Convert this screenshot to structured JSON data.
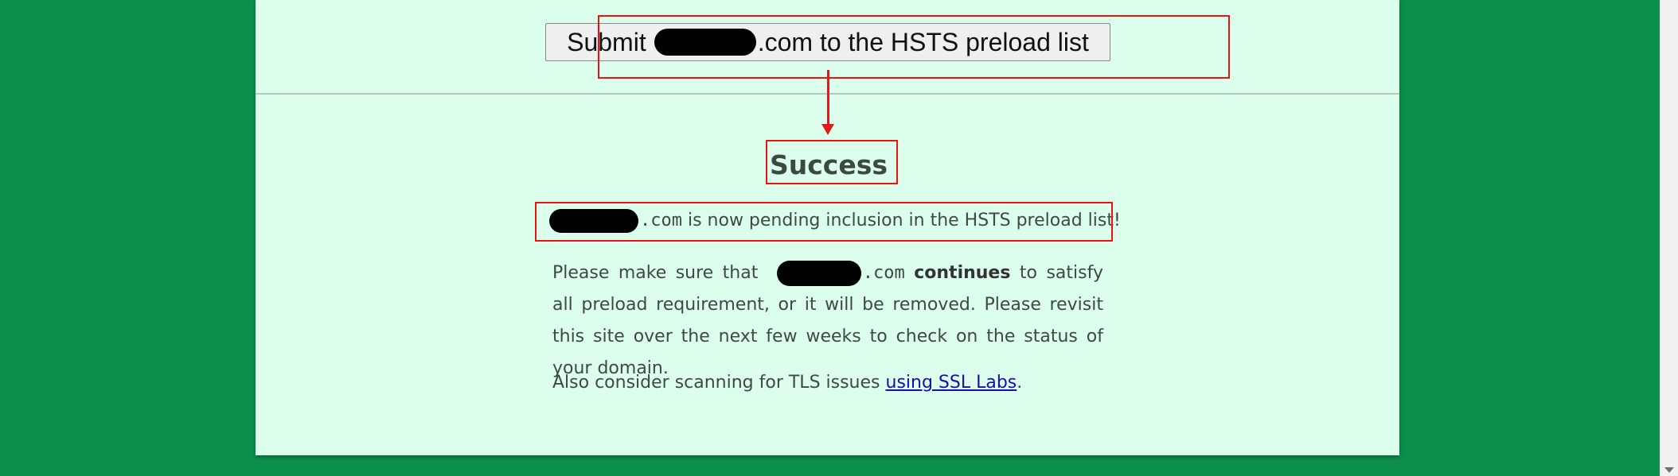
{
  "submit_button": {
    "prefix": "Submit",
    "suffix": ".com to the HSTS preload list"
  },
  "result": {
    "heading": "Success",
    "pending_suffix": ".com",
    "pending_text": " is now pending inclusion in the HSTS preload list!",
    "para_1": "Please make sure that",
    "para_domain": ".com",
    "para_bold": "continues",
    "para_2": "to satisfy all preload requirement, or it will be removed. Please revisit this site over the next few weeks to check on the status of your domain.",
    "tls_text": "Also consider scanning for TLS issues ",
    "tls_link": "using SSL Labs",
    "tls_end": "."
  },
  "colors": {
    "page_background": "#0c8f4b",
    "panel_background": "#dcfeed",
    "annotation_red": "#ee1111",
    "link": "#1a0dab"
  }
}
